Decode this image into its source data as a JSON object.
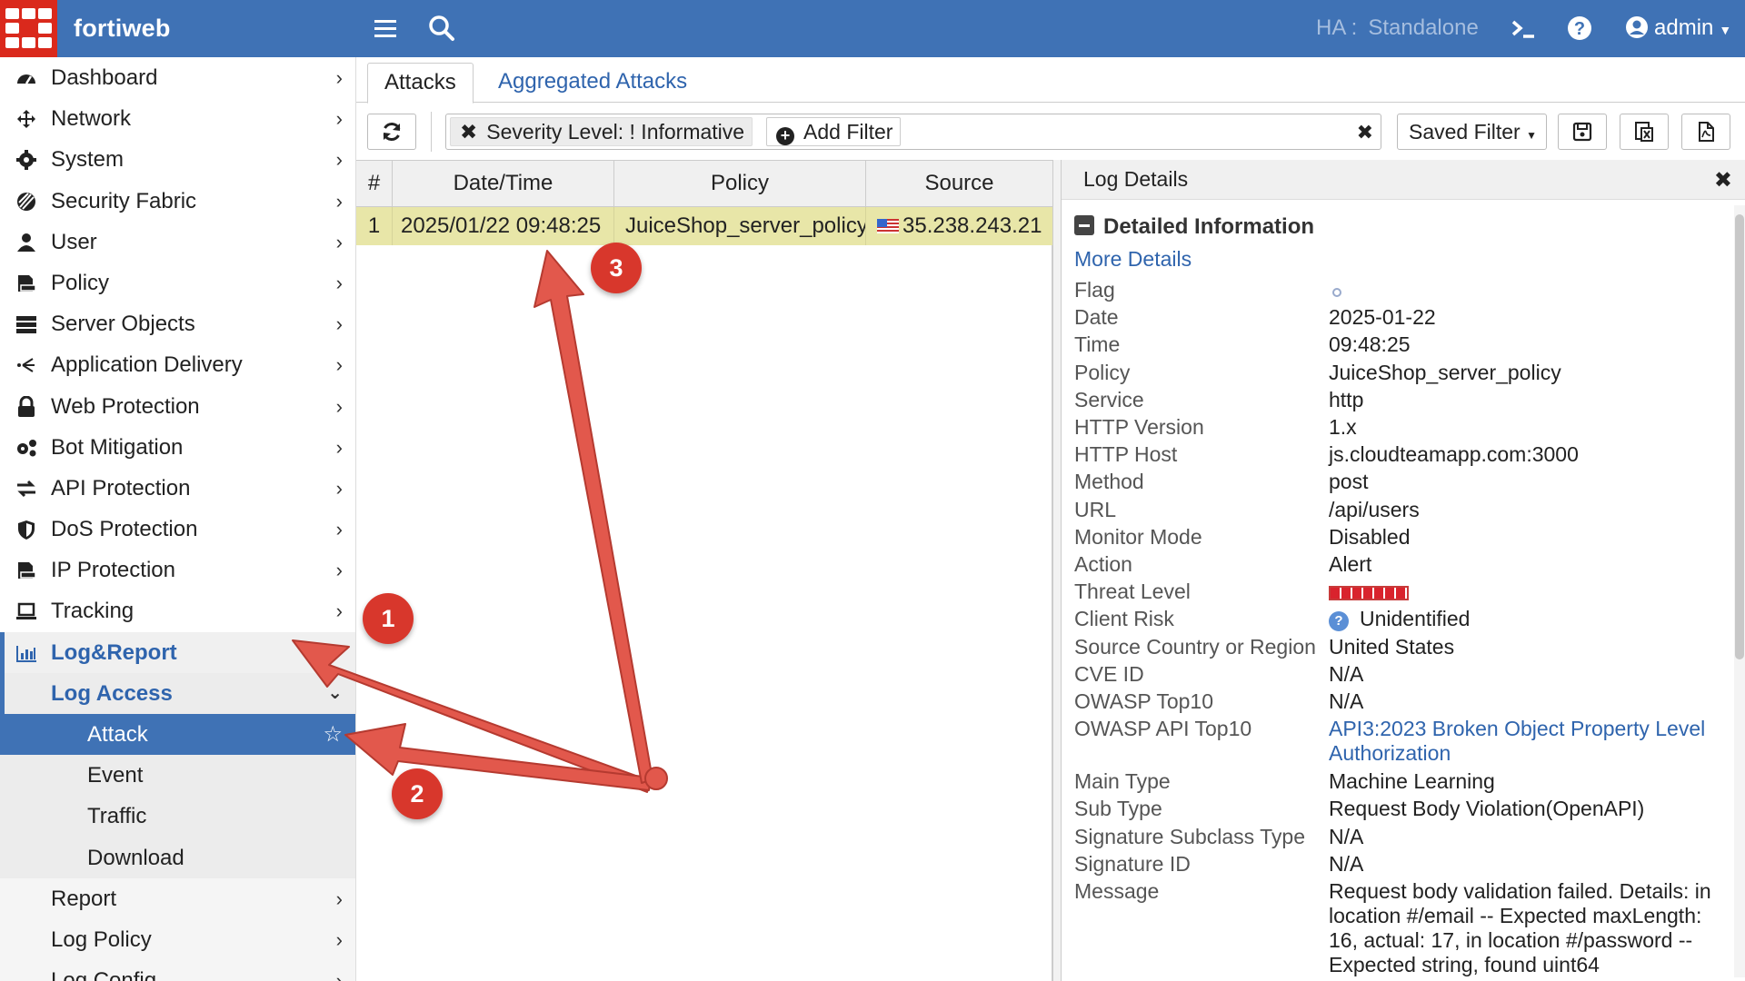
{
  "topbar": {
    "brand": "fortiweb",
    "ha_label": "HA :",
    "ha_value": "Standalone",
    "user": "admin"
  },
  "sidebar": {
    "items": [
      {
        "label": "Dashboard",
        "icon": "dashboard-icon"
      },
      {
        "label": "Network",
        "icon": "network-icon"
      },
      {
        "label": "System",
        "icon": "gear-icon"
      },
      {
        "label": "Security Fabric",
        "icon": "security-fabric-icon"
      },
      {
        "label": "User",
        "icon": "user-icon"
      },
      {
        "label": "Policy",
        "icon": "policy-icon"
      },
      {
        "label": "Server Objects",
        "icon": "server-icon"
      },
      {
        "label": "Application Delivery",
        "icon": "application-delivery-icon"
      },
      {
        "label": "Web Protection",
        "icon": "lock-icon"
      },
      {
        "label": "Bot Mitigation",
        "icon": "bot-icon"
      },
      {
        "label": "API Protection",
        "icon": "exchange-icon"
      },
      {
        "label": "DoS Protection",
        "icon": "shield-icon"
      },
      {
        "label": "IP Protection",
        "icon": "ip-icon"
      },
      {
        "label": "Tracking",
        "icon": "laptop-icon"
      }
    ],
    "log_report": "Log&Report",
    "log_access": "Log Access",
    "attack": "Attack",
    "event": "Event",
    "traffic": "Traffic",
    "download": "Download",
    "report": "Report",
    "log_policy": "Log Policy",
    "log_config": "Log Config"
  },
  "tabs": {
    "attacks": "Attacks",
    "aggregated": "Aggregated Attacks"
  },
  "toolbar": {
    "filter_key": "Severity Level:",
    "filter_value": "! Informative",
    "add_filter": "Add Filter",
    "saved_filter": "Saved Filter"
  },
  "table": {
    "headers": [
      "#",
      "Date/Time",
      "Policy",
      "Source"
    ],
    "rows": [
      {
        "num": "1",
        "datetime": "2025/01/22 09:48:25",
        "policy": "JuiceShop_server_policy",
        "source": "35.238.243.21"
      }
    ]
  },
  "details": {
    "title": "Log Details",
    "section": "Detailed Information",
    "more": "More Details",
    "fields": [
      {
        "k": "Flag",
        "v": ""
      },
      {
        "k": "Date",
        "v": "2025-01-22"
      },
      {
        "k": "Time",
        "v": "09:48:25"
      },
      {
        "k": "Policy",
        "v": "JuiceShop_server_policy"
      },
      {
        "k": "Service",
        "v": "http"
      },
      {
        "k": "HTTP Version",
        "v": "1.x"
      },
      {
        "k": "HTTP Host",
        "v": "js.cloudteamapp.com:3000"
      },
      {
        "k": "Method",
        "v": "post"
      },
      {
        "k": "URL",
        "v": "/api/users"
      },
      {
        "k": "Monitor Mode",
        "v": "Disabled"
      },
      {
        "k": "Action",
        "v": "Alert"
      },
      {
        "k": "Threat Level",
        "v": ""
      },
      {
        "k": "Client Risk",
        "v": "Unidentified"
      },
      {
        "k": "Source Country or Region",
        "v": "United States"
      },
      {
        "k": "CVE ID",
        "v": "N/A"
      },
      {
        "k": "OWASP Top10",
        "v": "N/A"
      },
      {
        "k": "OWASP API Top10",
        "v": "API3:2023 Broken Object Property Level Authorization"
      },
      {
        "k": "Main Type",
        "v": "Machine Learning"
      },
      {
        "k": "Sub Type",
        "v": "Request Body Violation(OpenAPI)"
      },
      {
        "k": "Signature Subclass Type",
        "v": "N/A"
      },
      {
        "k": "Signature ID",
        "v": "N/A"
      },
      {
        "k": "Message",
        "v": "Request body validation failed. Details: in location #/email -- Expected maxLength: 16, actual: 17, in location #/password -- Expected string, found uint64"
      }
    ]
  },
  "annotations": {
    "b1": "1",
    "b2": "2",
    "b3": "3"
  },
  "colors": {
    "brand_blue": "#3f72b5",
    "logo_red": "#da291c",
    "highlight_row": "#e8e6a8",
    "annotation_red": "#d8372c"
  }
}
